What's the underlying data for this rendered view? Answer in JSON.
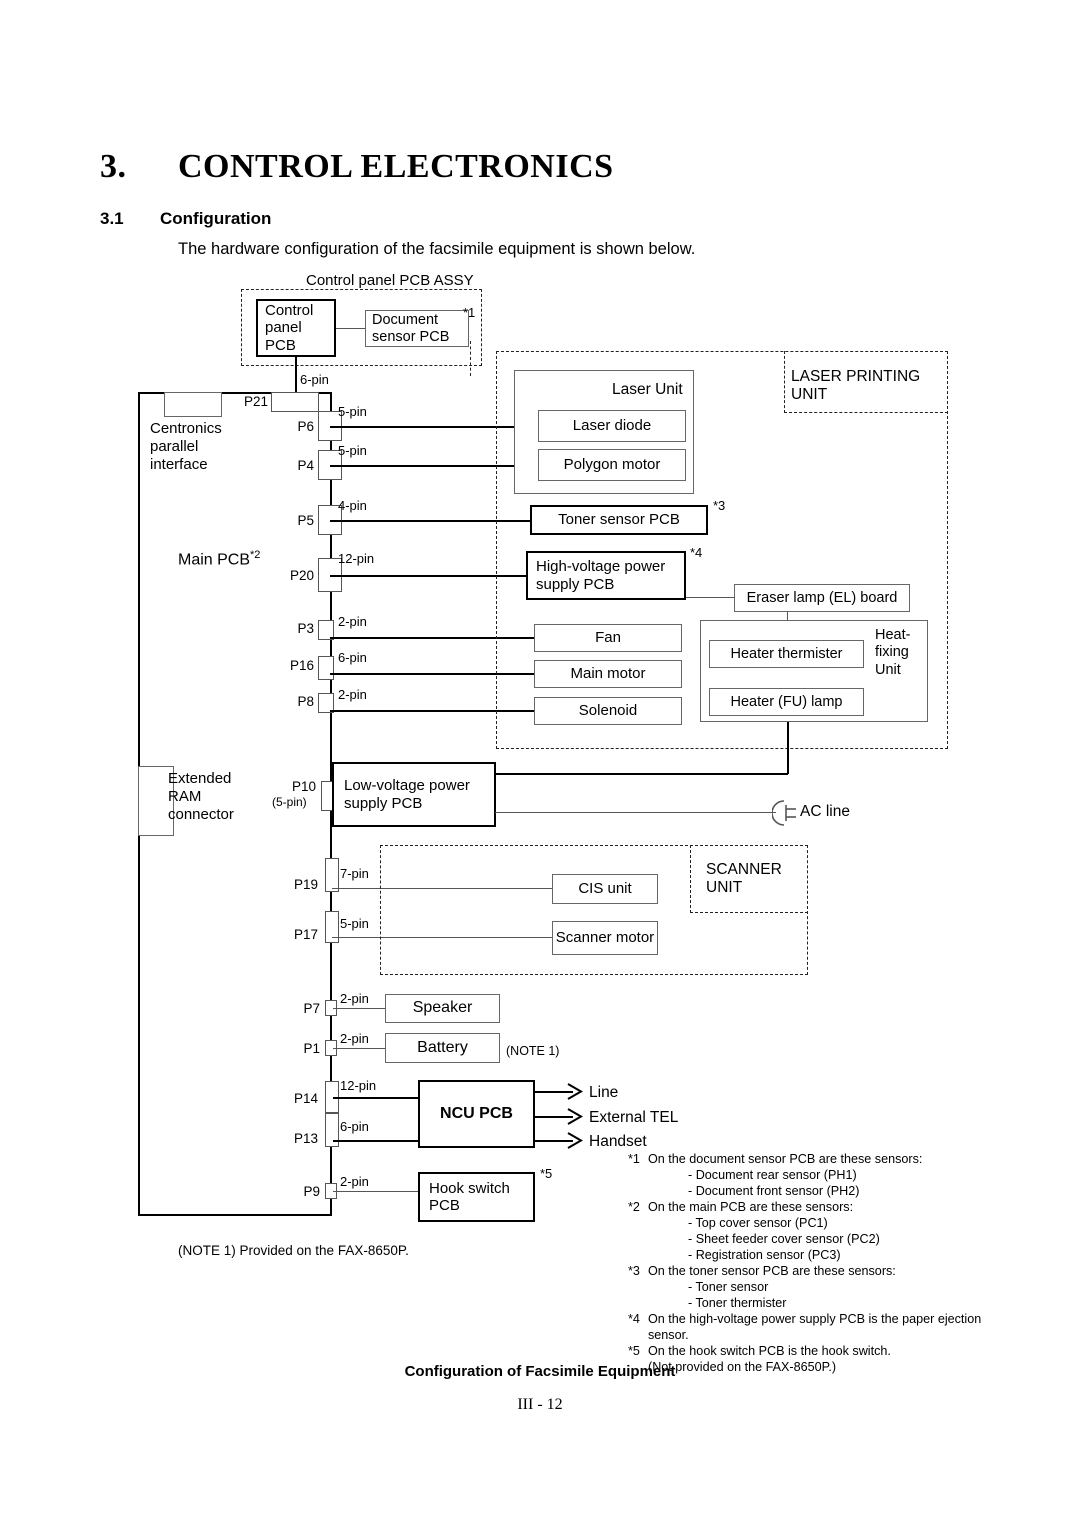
{
  "chapter": {
    "number": "3.",
    "title": "CONTROL ELECTRONICS"
  },
  "section": {
    "number": "3.1",
    "title": "Configuration"
  },
  "intro": "The hardware configuration of the facsimile equipment is shown below.",
  "groups": {
    "control_panel_assy": "Control panel PCB ASSY",
    "laser_printing_unit": "LASER PRINTING\nUNIT",
    "scanner_unit": "SCANNER\nUNIT",
    "heat_fixing_unit": "Heat-\nfixing\nUnit",
    "laser_unit": "Laser Unit"
  },
  "blocks": {
    "control_panel_pcb": "Control\npanel\nPCB",
    "document_sensor_pcb": "Document\nsensor PCB",
    "document_sensor_mark": "*1",
    "main_pcb": "Main PCB",
    "main_pcb_mark": "*2",
    "centronics": "Centronics\nparallel\ninterface",
    "extended_ram": "Extended\nRAM\nconnector",
    "laser_diode": "Laser diode",
    "polygon_motor": "Polygon motor",
    "toner_sensor_pcb": "Toner sensor PCB",
    "toner_sensor_mark": "*3",
    "high_voltage_psu": "High-voltage power\nsupply PCB",
    "high_voltage_mark": "*4",
    "eraser_lamp": "Eraser lamp (EL) board",
    "heater_thermister": "Heater thermister",
    "heater_fu_lamp": "Heater (FU) lamp",
    "fan": "Fan",
    "main_motor": "Main motor",
    "solenoid": "Solenoid",
    "low_voltage_psu": "Low-voltage power\nsupply PCB",
    "ac_line": "AC line",
    "cis_unit": "CIS unit",
    "scanner_motor": "Scanner motor",
    "speaker": "Speaker",
    "battery": "Battery",
    "battery_note": "(NOTE 1)",
    "ncu_pcb": "NCU PCB",
    "hook_switch_pcb": "Hook switch\nPCB",
    "hook_switch_mark": "*5"
  },
  "ports": [
    {
      "id": "P21",
      "pins": "6-pin"
    },
    {
      "id": "P6",
      "pins": "5-pin"
    },
    {
      "id": "P4",
      "pins": "5-pin"
    },
    {
      "id": "P5",
      "pins": "4-pin"
    },
    {
      "id": "P20",
      "pins": "12-pin"
    },
    {
      "id": "P3",
      "pins": "2-pin"
    },
    {
      "id": "P16",
      "pins": "6-pin"
    },
    {
      "id": "P8",
      "pins": "2-pin"
    },
    {
      "id": "P10",
      "pins": "(5-pin)"
    },
    {
      "id": "P19",
      "pins": "7-pin"
    },
    {
      "id": "P17",
      "pins": "5-pin"
    },
    {
      "id": "P7",
      "pins": "2-pin"
    },
    {
      "id": "P1",
      "pins": "2-pin"
    },
    {
      "id": "P14",
      "pins": "12-pin"
    },
    {
      "id": "P13",
      "pins": "6-pin"
    },
    {
      "id": "P9",
      "pins": "2-pin"
    }
  ],
  "outputs": {
    "line": "Line",
    "external_tel": "External TEL",
    "handset": "Handset"
  },
  "notes": {
    "n1": {
      "mark": "*1",
      "text": "On the document sensor PCB are these sensors:",
      "subs": [
        "- Document rear sensor (PH1)",
        "- Document front sensor (PH2)"
      ]
    },
    "n2": {
      "mark": "*2",
      "text": "On the main PCB are these sensors:",
      "subs": [
        "- Top cover sensor (PC1)",
        "- Sheet feeder cover sensor (PC2)",
        "- Registration sensor (PC3)"
      ]
    },
    "n3": {
      "mark": "*3",
      "text": "On the toner sensor PCB are these sensors:",
      "subs": [
        "- Toner sensor",
        "- Toner thermister"
      ]
    },
    "n4": {
      "mark": "*4",
      "text": "On the high-voltage power supply PCB is the paper ejection sensor.",
      "subs": []
    },
    "n5": {
      "mark": "*5",
      "text": "On the hook switch PCB is the hook switch.",
      "subs": [
        "(Not provided on the FAX-8650P.)"
      ]
    },
    "note1": "(NOTE 1)  Provided on the FAX-8650P."
  },
  "caption": "Configuration of Facsimile Equipment",
  "page_number": "III - 12"
}
